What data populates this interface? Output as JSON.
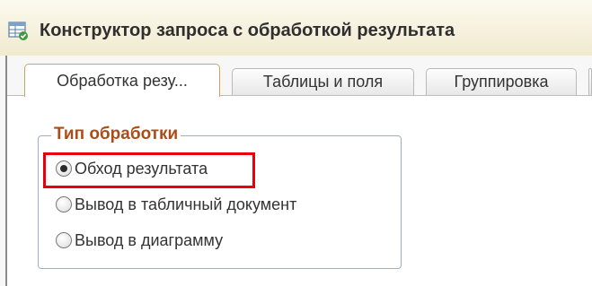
{
  "window": {
    "title": "Конструктор запроса с обработкой результата",
    "icon": "query-builder-icon"
  },
  "tabs": [
    {
      "label": "Обработка резу...",
      "active": true
    },
    {
      "label": "Таблицы и поля",
      "active": false
    },
    {
      "label": "Группировка",
      "active": false
    }
  ],
  "processing_group": {
    "title": "Тип обработки",
    "options": [
      {
        "label": "Обход результата",
        "selected": true
      },
      {
        "label": "Вывод в табличный документ",
        "selected": false
      },
      {
        "label": "Вывод в диаграмму",
        "selected": false
      }
    ]
  },
  "colors": {
    "group_title": "#ab4d18",
    "highlight": "#e8000c",
    "active_tab_border": "#d4a15a"
  }
}
